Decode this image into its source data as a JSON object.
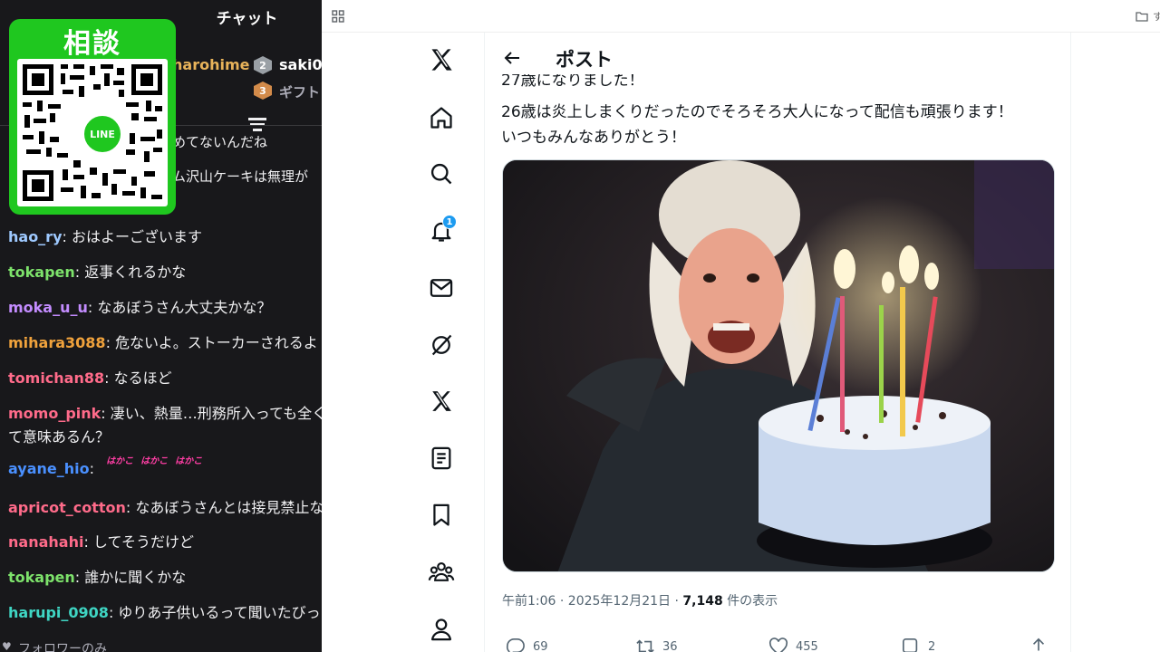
{
  "chat": {
    "header_title": "チャット",
    "pinned": {
      "user1": "harohime",
      "rank2": "2",
      "user2": "saki0",
      "rank3": "3",
      "gift": "ギフト"
    },
    "partial_lines": [
      "めてないんだね",
      "ム沢山ケーキは無理が"
    ],
    "messages": [
      {
        "user": "hao_ry",
        "color": "#9ec9ff",
        "text": "おはよーございます"
      },
      {
        "user": "tokapen",
        "color": "#7de26b",
        "text": "返事くれるかな"
      },
      {
        "user": "moka_u_u",
        "color": "#c38cff",
        "text": "なあぼうさん大丈夫かな？"
      },
      {
        "user": "mihara3088",
        "color": "#f0a23c",
        "text": "危ないよ。ストーカーされるよ"
      },
      {
        "user": "tomichan88",
        "color": "#ff6b8a",
        "text": "なるほど"
      },
      {
        "user": "momo_pink",
        "color": "#ff6b8a",
        "text": "凄い、熱量…刑務所入っても全く"
      },
      {
        "user": "",
        "color": "#efeff1",
        "text": "て意味あるん？"
      },
      {
        "user": "ayane_hio",
        "color": "#4a90ff",
        "text": ""
      },
      {
        "user": "apricot_cotton",
        "color": "#ff6b8a",
        "text": "なあぼうさんとは接見禁止な"
      },
      {
        "user": "nanahahi",
        "color": "#ff6b8a",
        "text": "してそうだけど"
      },
      {
        "user": "tokapen",
        "color": "#7de26b",
        "text": "誰かに聞くかな"
      },
      {
        "user": "harupi_0908",
        "color": "#3fd6c4",
        "text": "ゆりあ子供いるって聞いたびっ"
      }
    ],
    "emote_text": [
      "はかこ",
      "はかこ",
      "はかこ"
    ],
    "footer": "フォロワーのみ"
  },
  "qr": {
    "title": "相談",
    "badge": "LINE"
  },
  "browser": {
    "folder_label": "す"
  },
  "nav": {
    "notification_count": "1"
  },
  "post": {
    "title": "ポスト",
    "line_cut": "27歳になりました！",
    "line1": "26歳は炎上しまくりだったのでそろそろ大人になって配信も頑張ります！",
    "line2": "いつもみんなありがとう！",
    "meta_time": "午前1:06 · 2025年12月21日 · ",
    "meta_views": "7,148",
    "meta_views_suffix": " 件の表示",
    "replies": "69",
    "reposts": "36",
    "likes": "455",
    "bookmarks": "2"
  }
}
